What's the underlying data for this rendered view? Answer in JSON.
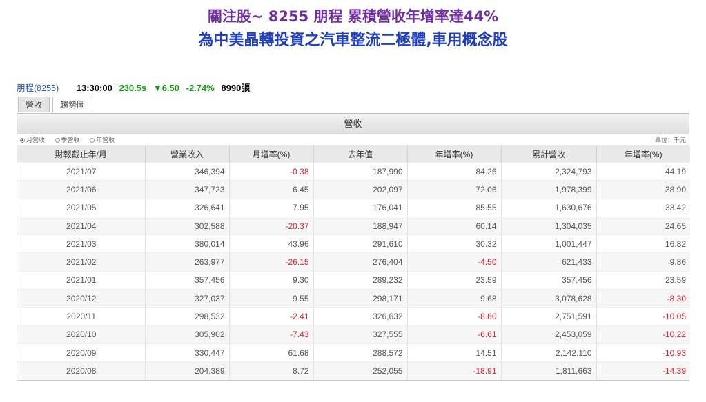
{
  "headline": {
    "line1": "關注股~ 8255 朋程   累積營收年增率達44%",
    "line2": "為中美晶轉投資之汽車整流二極體,車用概念股"
  },
  "quote": {
    "name": "朋程(8255)",
    "time": "13:30:00",
    "price": "230.5s",
    "change": "▼6.50",
    "change_pct": "-2.74%",
    "volume": "8990張"
  },
  "tabs": [
    "營收",
    "趨勢圖"
  ],
  "table": {
    "title": "營收",
    "options": [
      "月營收",
      "季營收",
      "年營收"
    ],
    "unit": "單位：千元",
    "headers": [
      "財報截止年/月",
      "營業收入",
      "月增率(%)",
      "去年值",
      "年增率(%)",
      "累計營收",
      "年增率(%)"
    ],
    "rows": [
      [
        "2021/07",
        "346,394",
        "-0.38",
        "187,990",
        "84.26",
        "2,324,793",
        "44.19"
      ],
      [
        "2021/06",
        "347,723",
        "6.45",
        "202,097",
        "72.06",
        "1,978,399",
        "38.90"
      ],
      [
        "2021/05",
        "326,641",
        "7.95",
        "176,041",
        "85.55",
        "1,630,676",
        "33.42"
      ],
      [
        "2021/04",
        "302,588",
        "-20.37",
        "188,947",
        "60.14",
        "1,304,035",
        "24.65"
      ],
      [
        "2021/03",
        "380,014",
        "43.96",
        "291,610",
        "30.32",
        "1,001,447",
        "16.82"
      ],
      [
        "2021/02",
        "263,977",
        "-26.15",
        "276,404",
        "-4.50",
        "621,433",
        "9.86"
      ],
      [
        "2021/01",
        "357,456",
        "9.30",
        "289,232",
        "23.59",
        "357,456",
        "23.59"
      ],
      [
        "2020/12",
        "327,037",
        "9.55",
        "298,171",
        "9.68",
        "3,078,628",
        "-8.30"
      ],
      [
        "2020/11",
        "298,532",
        "-2.41",
        "326,632",
        "-8.60",
        "2,751,591",
        "-10.05"
      ],
      [
        "2020/10",
        "305,902",
        "-7.43",
        "327,555",
        "-6.61",
        "2,453,059",
        "-10.22"
      ],
      [
        "2020/09",
        "330,447",
        "61.68",
        "288,572",
        "14.51",
        "2,142,110",
        "-10.93"
      ],
      [
        "2020/08",
        "204,389",
        "8.72",
        "252,055",
        "-18.91",
        "1,811,663",
        "-14.39"
      ]
    ]
  },
  "colors": {
    "headline1": "#7030a0",
    "headline2": "#1f3fbf",
    "down": "#139913",
    "negative": "#e0202a"
  }
}
